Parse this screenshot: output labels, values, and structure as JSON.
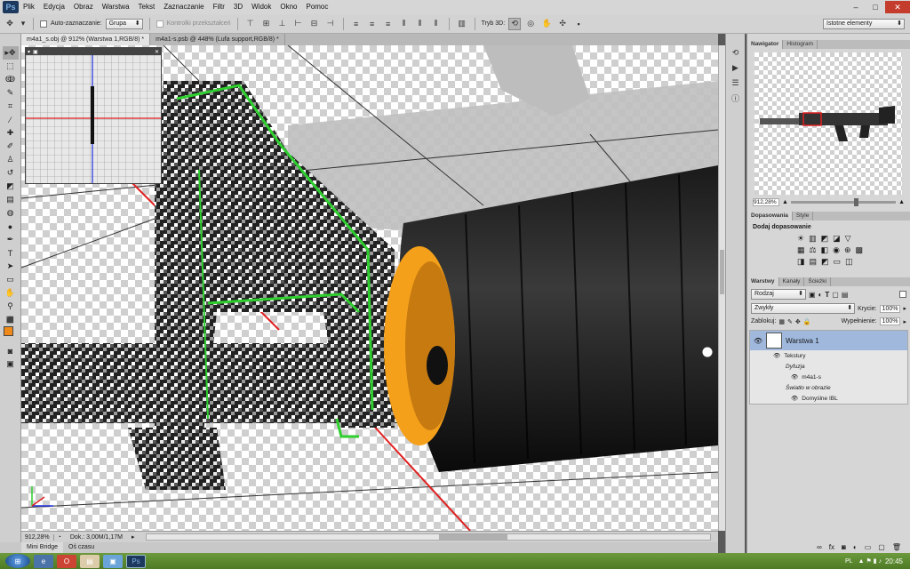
{
  "app": {
    "logo": "Ps"
  },
  "menu": [
    "Plik",
    "Edycja",
    "Obraz",
    "Warstwa",
    "Tekst",
    "Zaznaczanie",
    "Filtr",
    "3D",
    "Widok",
    "Okno",
    "Pomoc"
  ],
  "window_controls": {
    "minimize": "–",
    "maximize": "□",
    "close": "✕"
  },
  "options": {
    "auto_select_label": "Auto-zaznaczanie:",
    "auto_select_value": "Grupa",
    "transform_controls_label": "Kontrolki przekształceń",
    "mode3d_label": "Tryb 3D:",
    "essentials": "Istotne elementy"
  },
  "tabs": [
    {
      "label": "m4a1_s.obj @ 912% (Warstwa 1,RGB/8) *"
    },
    {
      "label": "m4a1-s.psb @ 448% (Lufa support,RGB/8) *"
    }
  ],
  "status": {
    "zoom": "912,28%",
    "doc": "Dok.: 3,00M/1,17M"
  },
  "bottom_tabs": [
    "Mini Bridge",
    "Oś czasu"
  ],
  "navigator": {
    "tabs": [
      "Nawigator",
      "Histogram"
    ],
    "zoom": "912,28%",
    "zoom_level": 0.6
  },
  "adjustments": {
    "tabs": [
      "Dopasowania",
      "Style"
    ],
    "title": "Dodaj dopasowanie"
  },
  "layers": {
    "tabs": [
      "Warstwy",
      "Kanały",
      "Ścieżki"
    ],
    "filter": "Rodzaj",
    "blend": "Zwykły",
    "opacity_label": "Krycie:",
    "opacity": "100%",
    "lock_label": "Zablokuj:",
    "fill_label": "Wypełnienie:",
    "fill": "100%",
    "items": [
      {
        "name": "Warstwa 1",
        "selected": true,
        "indent": 0
      },
      {
        "name": "Tekstury",
        "indent": 1
      },
      {
        "name": "Dyfuzja",
        "indent": 2,
        "italic": true
      },
      {
        "name": "m4a1-s",
        "indent": 3
      },
      {
        "name": "Światło w obrazie",
        "indent": 2,
        "italic": true
      },
      {
        "name": "Domyślne IBL",
        "indent": 3
      }
    ]
  },
  "taskbar": {
    "lang": "PL",
    "clock": "20:45"
  },
  "colors": {
    "accent_orange": "#f5a01a",
    "bright_green": "#2ecf2e",
    "axis_red": "#e02020",
    "axis_blue": "#2030e0",
    "fg_swatch": "#ef8a1a",
    "bg_swatch": "#1a1a1a"
  }
}
